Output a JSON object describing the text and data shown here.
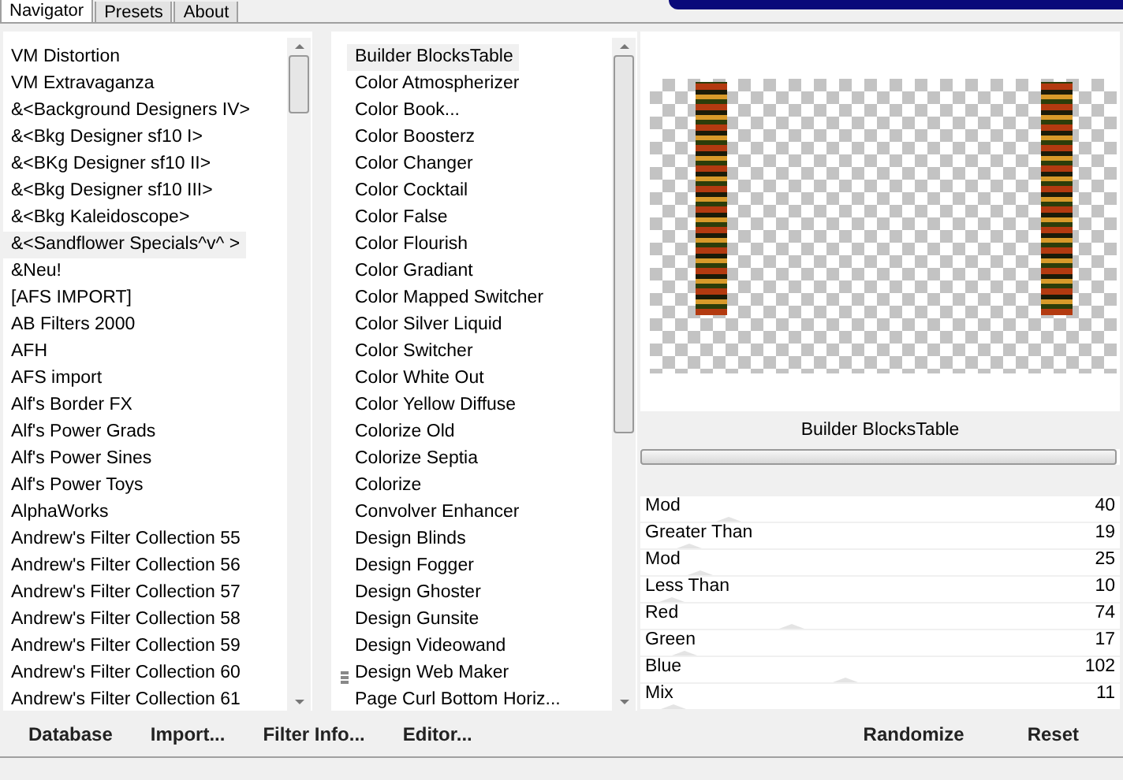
{
  "tabs": [
    {
      "label": "Navigator",
      "selected": true
    },
    {
      "label": "Presets",
      "selected": false
    },
    {
      "label": "About",
      "selected": false
    }
  ],
  "categories": [
    {
      "label": "VM Distortion",
      "selected": false
    },
    {
      "label": "VM Extravaganza",
      "selected": false
    },
    {
      "label": "&<Background Designers IV>",
      "selected": false
    },
    {
      "label": "&<Bkg Designer sf10 I>",
      "selected": false
    },
    {
      "label": "&<BKg Designer sf10 II>",
      "selected": false
    },
    {
      "label": "&<Bkg Designer sf10 III>",
      "selected": false
    },
    {
      "label": "&<Bkg Kaleidoscope>",
      "selected": false
    },
    {
      "label": "&<Sandflower Specials^v^ >",
      "selected": true
    },
    {
      "label": "&Neu!",
      "selected": false
    },
    {
      "label": "[AFS IMPORT]",
      "selected": false
    },
    {
      "label": "AB Filters 2000",
      "selected": false
    },
    {
      "label": "AFH",
      "selected": false
    },
    {
      "label": "AFS import",
      "selected": false
    },
    {
      "label": "Alf's Border FX",
      "selected": false
    },
    {
      "label": "Alf's Power Grads",
      "selected": false
    },
    {
      "label": "Alf's Power Sines",
      "selected": false
    },
    {
      "label": "Alf's Power Toys",
      "selected": false
    },
    {
      "label": "AlphaWorks",
      "selected": false
    },
    {
      "label": "Andrew's Filter Collection 55",
      "selected": false
    },
    {
      "label": "Andrew's Filter Collection 56",
      "selected": false
    },
    {
      "label": "Andrew's Filter Collection 57",
      "selected": false
    },
    {
      "label": "Andrew's Filter Collection 58",
      "selected": false
    },
    {
      "label": "Andrew's Filter Collection 59",
      "selected": false
    },
    {
      "label": "Andrew's Filter Collection 60",
      "selected": false
    },
    {
      "label": "Andrew's Filter Collection 61",
      "selected": false
    }
  ],
  "filters": [
    {
      "label": "Builder BlocksTable",
      "selected": true
    },
    {
      "label": "Color Atmospherizer",
      "selected": false
    },
    {
      "label": "Color Book...",
      "selected": false
    },
    {
      "label": "Color Boosterz",
      "selected": false
    },
    {
      "label": "Color Changer",
      "selected": false
    },
    {
      "label": "Color Cocktail",
      "selected": false
    },
    {
      "label": "Color False",
      "selected": false
    },
    {
      "label": "Color Flourish",
      "selected": false
    },
    {
      "label": "Color Gradiant",
      "selected": false
    },
    {
      "label": "Color Mapped Switcher",
      "selected": false
    },
    {
      "label": "Color Silver Liquid",
      "selected": false
    },
    {
      "label": "Color Switcher",
      "selected": false
    },
    {
      "label": "Color White Out",
      "selected": false
    },
    {
      "label": "Color Yellow Diffuse",
      "selected": false
    },
    {
      "label": "Colorize Old",
      "selected": false
    },
    {
      "label": "Colorize Septia",
      "selected": false
    },
    {
      "label": "Colorize",
      "selected": false
    },
    {
      "label": "Convolver Enhancer",
      "selected": false
    },
    {
      "label": "Design Blinds",
      "selected": false
    },
    {
      "label": "Design Fogger",
      "selected": false
    },
    {
      "label": "Design Ghoster",
      "selected": false
    },
    {
      "label": "Design Gunsite",
      "selected": false
    },
    {
      "label": "Design Videowand",
      "selected": false
    },
    {
      "label": "Design Web Maker",
      "selected": false
    },
    {
      "label": "Page Curl Bottom Horiz...",
      "selected": false
    }
  ],
  "filter_title": "Builder BlocksTable",
  "parameters": [
    {
      "name": "Mod",
      "value": "40",
      "level": 0.157
    },
    {
      "name": "Greater Than",
      "value": "19",
      "level": 0.075
    },
    {
      "name": "Mod",
      "value": "25",
      "level": 0.098
    },
    {
      "name": "Less Than",
      "value": "10",
      "level": 0.039
    },
    {
      "name": "Red",
      "value": "74",
      "level": 0.29
    },
    {
      "name": "Green",
      "value": "17",
      "level": 0.067
    },
    {
      "name": "Blue",
      "value": "102",
      "level": 0.4
    },
    {
      "name": "Mix",
      "value": "11",
      "level": 0.043
    }
  ],
  "left_buttons": [
    "Database",
    "Import...",
    "Filter Info...",
    "Editor..."
  ],
  "right_buttons": [
    "Randomize",
    "Reset"
  ]
}
